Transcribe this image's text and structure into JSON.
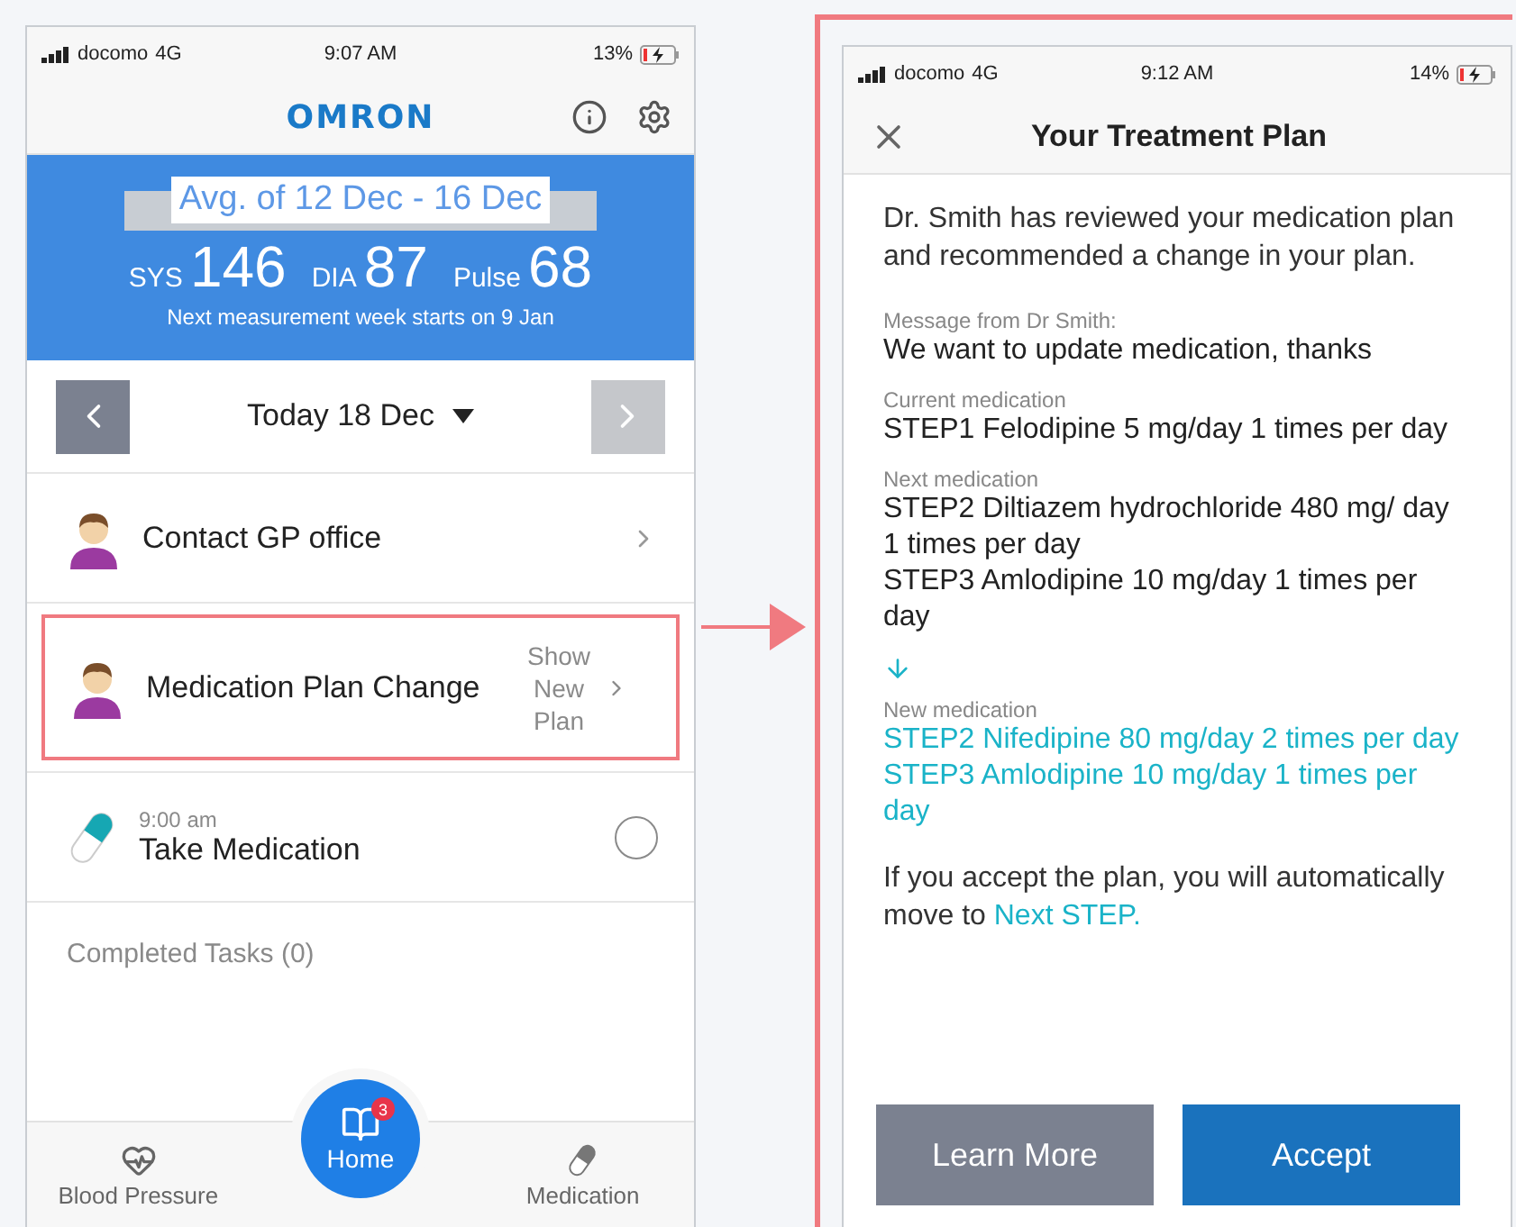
{
  "left_screen": {
    "status_bar": {
      "carrier": "docomo",
      "network": "4G",
      "time": "9:07 AM",
      "battery": "13%"
    },
    "header": {
      "logo": "OMRON"
    },
    "summary": {
      "title": "Avg. of 12 Dec - 16 Dec",
      "readings": [
        {
          "label": "SYS",
          "value": "146"
        },
        {
          "label": "DIA",
          "value": "87"
        },
        {
          "label": "Pulse",
          "value": "68"
        }
      ],
      "note": "Next measurement week starts on 9 Jan"
    },
    "date_nav": {
      "label": "Today 18 Dec"
    },
    "tasks": [
      {
        "kind": "contact",
        "title": "Contact GP office",
        "highlighted": false
      },
      {
        "kind": "contact",
        "title": "Medication Plan Change",
        "action": "Show New Plan",
        "highlighted": true
      },
      {
        "kind": "medication",
        "time": "9:00 am",
        "title": "Take Medication",
        "checked": false,
        "highlighted": false
      }
    ],
    "completed_tasks": "Completed Tasks (0)",
    "tab_bar": [
      {
        "kind": "heart",
        "label": "Blood Pressure",
        "selected": false
      },
      {
        "kind": "book",
        "label": "Home",
        "selected": true,
        "badge": "3"
      },
      {
        "kind": "pill",
        "label": "Medication",
        "selected": false
      }
    ]
  },
  "right_screen": {
    "highlighted": true,
    "status_bar": {
      "carrier": "docomo",
      "network": "4G",
      "time": "9:12 AM",
      "battery": "14%"
    },
    "title": "Your Treatment Plan",
    "intro": "Dr. Smith has reviewed your medication plan and recommended a change in your plan.",
    "sections": [
      {
        "kind": "plain",
        "label": "Message from Dr Smith:",
        "lines": [
          "We want to update medication, thanks"
        ]
      },
      {
        "kind": "plain",
        "label": "Current medication",
        "lines": [
          "STEP1 Felodipine 5 mg/day 1 times per day"
        ]
      },
      {
        "kind": "plain",
        "label": "Next medication",
        "lines": [
          "STEP2 Diltiazem hydrochloride 480 mg/ day 1 times per day",
          "STEP3 Amlodipine 10 mg/day 1 times per day"
        ]
      },
      {
        "kind": "new",
        "label": "New medication",
        "lines": [
          "STEP2 Nifedipine 80 mg/day 2 times per day",
          "STEP3 Amlodipine 10 mg/day 1 times per day"
        ]
      }
    ],
    "footer": {
      "text": "If you accept the plan, you will automatically move to",
      "link": "Next STEP."
    },
    "buttons": [
      {
        "kind": "secondary",
        "label": "Learn More"
      },
      {
        "kind": "primary",
        "label": "Accept"
      }
    ]
  }
}
